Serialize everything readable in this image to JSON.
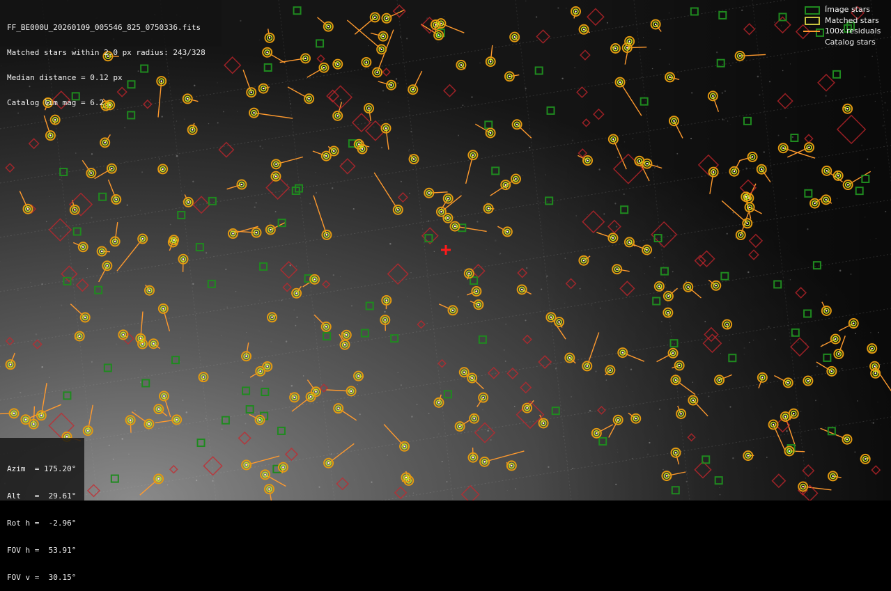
{
  "info": {
    "filename": "FF_BE000U_20260109_005546_825_0750336.fits",
    "matched": "Matched stars within 2.0 px radius: 243/328",
    "median": "Median distance = 0.12 px",
    "limmag": "Catalog lim mag = 6.2"
  },
  "legend": {
    "image_stars": "Image stars",
    "matched_stars": "Matched stars",
    "residuals": "100x residuals",
    "catalog_stars": "Catalog stars"
  },
  "pointing": {
    "azim": "Azim  = 175.20°",
    "alt": "Alt   =  29.61°",
    "rot": "Rot h =  -2.96°",
    "fovh": "FOV h =  53.91°",
    "fovv": "FOV v =  30.15°"
  },
  "colors": {
    "image_star": "#1f8a1f",
    "matched_star": "#c9c440",
    "residual": "#ff9a2e",
    "catalog_star": "#c8262c",
    "matched_ring": "#e39a10",
    "center_marker": "#ff1a1a"
  }
}
